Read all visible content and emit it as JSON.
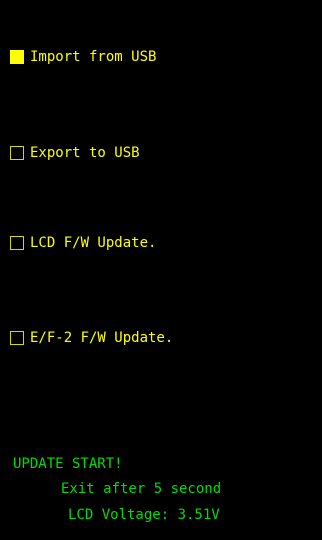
{
  "colors": {
    "background": "#000000",
    "menu_text": "#ffff00",
    "status_text": "#00dd00"
  },
  "menu": {
    "items": [
      {
        "label": "Import from USB",
        "checked": true
      },
      {
        "label": "Export to USB",
        "checked": false
      },
      {
        "label": "LCD F/W Update.",
        "checked": false
      },
      {
        "label": "E/F-2 F/W Update.",
        "checked": false
      }
    ]
  },
  "status": {
    "message": "UPDATE START!",
    "exit_notice": "Exit after 5 second",
    "voltage": "LCD Voltage: 3.51V"
  }
}
